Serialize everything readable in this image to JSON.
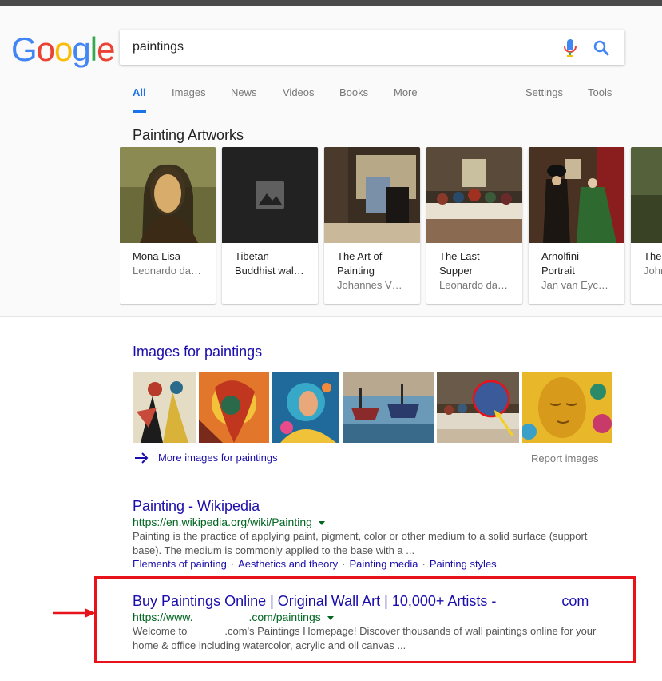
{
  "search": {
    "query": "paintings"
  },
  "tabs": {
    "all": "All",
    "images": "Images",
    "news": "News",
    "videos": "Videos",
    "books": "Books",
    "more": "More",
    "settings": "Settings",
    "tools": "Tools"
  },
  "knowledge_panel": {
    "title": "Painting Artworks",
    "cards": [
      {
        "title": "Mona Lisa",
        "subtitle": "Leonardo da…"
      },
      {
        "title": "Tibetan Buddhist wal…",
        "subtitle": ""
      },
      {
        "title": "The Art of Painting",
        "subtitle": "Johannes V…"
      },
      {
        "title": "The Last Supper",
        "subtitle": "Leonardo da…"
      },
      {
        "title": "Arnolfini Portrait",
        "subtitle": "Jan van Eyc…"
      },
      {
        "title": "The",
        "subtitle": "John"
      }
    ]
  },
  "images_section": {
    "title": "Images for paintings",
    "more_label": "More images for paintings",
    "report_label": "Report images"
  },
  "results": [
    {
      "title": "Painting - Wikipedia",
      "url": "https://en.wikipedia.org/wiki/Painting",
      "snippet": "Painting is the practice of applying paint, pigment, color or other medium to a solid surface (support base). The medium is commonly applied to the base with a ...",
      "sitelinks": [
        "Elements of painting",
        "Aesthetics and theory",
        "Painting media",
        "Painting styles"
      ]
    },
    {
      "title_part1": "Buy Paintings Online | Original Wall Art | 10,000+ Artists -",
      "title_part2": "com",
      "url_part1": "https://www.",
      "url_part2": ".com/paintings",
      "snippet_part1": "Welcome to",
      "snippet_part2": ".com's Paintings Homepage! Discover thousands of wall paintings online for your home & office including watercolor, acrylic and oil canvas ..."
    }
  ],
  "colors": {
    "link": "#1a0dab",
    "url": "#006621",
    "snippet": "#545454",
    "accent": "#1a73e8",
    "highlight": "#e8121b"
  },
  "icons": {
    "mic": "microphone-icon",
    "search": "search-icon",
    "placeholder": "image-placeholder-icon",
    "more_arrow": "arrow-right-icon"
  }
}
